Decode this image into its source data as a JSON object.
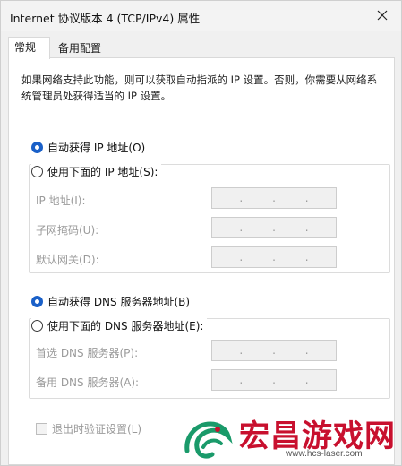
{
  "window": {
    "title": "Internet 协议版本 4 (TCP/IPv4) 属性"
  },
  "tabs": [
    {
      "label": "常规",
      "active": true
    },
    {
      "label": "备用配置",
      "active": false
    }
  ],
  "general": {
    "description": "如果网络支持此功能，则可以获取自动指派的 IP 设置。否则，你需要从网络系统管理员处获得适当的 IP 设置。",
    "ip_auto_label": "自动获得 IP 地址(O)",
    "ip_auto_checked": true,
    "ip_manual_label": "使用下面的 IP 地址(S):",
    "ip_manual_checked": false,
    "ip_fields": [
      {
        "label": "IP 地址(I):",
        "value": ".  .  ."
      },
      {
        "label": "子网掩码(U):",
        "value": ".  .  ."
      },
      {
        "label": "默认网关(D):",
        "value": ".  .  ."
      }
    ],
    "dns_auto_label": "自动获得 DNS 服务器地址(B)",
    "dns_auto_checked": true,
    "dns_manual_label": "使用下面的 DNS 服务器地址(E):",
    "dns_manual_checked": false,
    "dns_fields": [
      {
        "label": "首选 DNS 服务器(P):",
        "value": ".  .  ."
      },
      {
        "label": "备用 DNS 服务器(A):",
        "value": ".  .  ."
      }
    ],
    "validate_label": "退出时验证设置(L)",
    "validate_checked": false
  },
  "watermark": {
    "text": "宏昌游戏网",
    "url": "www.hcs-laser.com",
    "color": "#c8102e",
    "accent": "#1a9a6a"
  },
  "colors": {
    "accent": "#1a60c8",
    "disabled_text": "#9a9a9a"
  }
}
